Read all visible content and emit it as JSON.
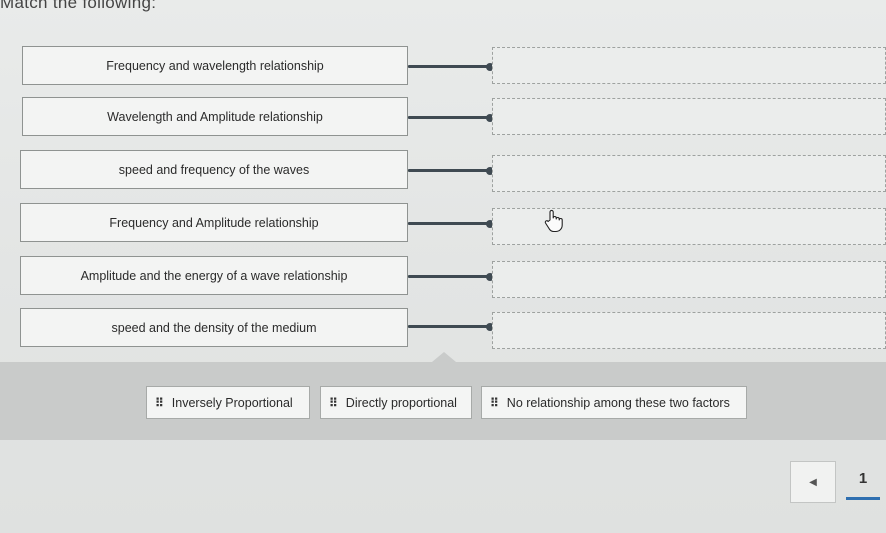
{
  "instruction": "Match the following:",
  "prompts": [
    "Frequency and wavelength relationship",
    "Wavelength and Amplitude relationship",
    "speed and frequency of the waves",
    "Frequency and Amplitude relationship",
    "Amplitude and the energy of a wave relationship",
    "speed and the density of the medium"
  ],
  "answer_choices": [
    "Inversely Proportional",
    "Directly proportional",
    "No relationship among these two factors"
  ],
  "pager": {
    "prev_icon": "chevron-left-icon",
    "current_page": "1"
  },
  "colors": {
    "connector": "#3f4a52",
    "accent": "#2f6fb0",
    "bank": "#c9cbca"
  }
}
